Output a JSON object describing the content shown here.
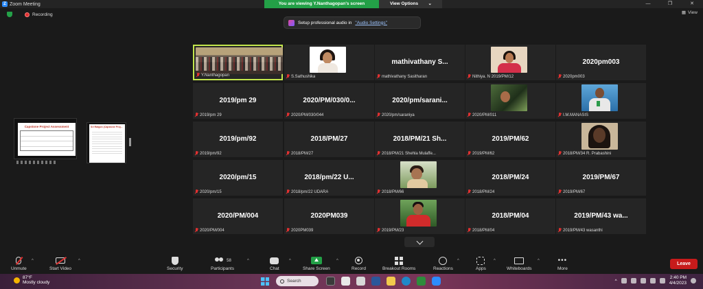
{
  "window": {
    "title": "Zoom Meeting",
    "controls": [
      "—",
      "❐",
      "✕"
    ]
  },
  "banner": {
    "viewing": "You are viewing Y.Nanthagopan's screen",
    "view_options": "View Options",
    "caret": "⌄"
  },
  "status": {
    "recording": "Recording",
    "view": "View"
  },
  "audio_tip": {
    "text": "Setup professional audio in",
    "link": "\"Audio Settings\""
  },
  "slides": {
    "thumb1_title": "Capstone Project Assessment",
    "thumb2_title": "Sri Ratgon (Capstone Proj..."
  },
  "participants": [
    {
      "label": "Y.Nanthagopan",
      "big": "",
      "photo": "room",
      "active": true
    },
    {
      "label": "S.Sathushika",
      "big": "",
      "photo": "girl1"
    },
    {
      "label": "mathivathany Sasitharan",
      "big": "mathivathany  S..."
    },
    {
      "label": "Nithiya. N 2019/PM/12",
      "big": "",
      "photo": "girl2"
    },
    {
      "label": "2020pm003",
      "big": "2020pm003"
    },
    {
      "label": "2019/pm 29",
      "big": "2019/pm 29"
    },
    {
      "label": "2020/PM/030/044",
      "big": "2020/PM/030/0..."
    },
    {
      "label": "2020/pm/saraniya",
      "big": "2020/pm/sarani..."
    },
    {
      "label": "2020/PM/011",
      "big": "",
      "photo": "boyg"
    },
    {
      "label": "I.M.MANASIS",
      "big": "",
      "photo": "man"
    },
    {
      "label": "2019/pm/92",
      "big": "2019/pm/92"
    },
    {
      "label": "2018/PM/27",
      "big": "2018/PM/27"
    },
    {
      "label": "2018/PM/21 Shehla Mulaffe...",
      "big": "2018/PM/21  Sh..."
    },
    {
      "label": "2019/PM/62",
      "big": "2019/PM/62"
    },
    {
      "label": "2018/PM/34 R. Prabashini",
      "big": "",
      "photo": "woman"
    },
    {
      "label": "2020/pm/15",
      "big": "2020/pm/15"
    },
    {
      "label": "2018/pm/22  UDARA",
      "big": "2018/pm/22   U..."
    },
    {
      "label": "2018/PM/66",
      "big": "",
      "photo": "outdoor"
    },
    {
      "label": "2018/PM/24",
      "big": "2018/PM/24"
    },
    {
      "label": "2019/PM/67",
      "big": "2019/PM/67"
    },
    {
      "label": "2020/PM/004",
      "big": "2020/PM/004"
    },
    {
      "label": "2020PM039",
      "big": "2020PM039"
    },
    {
      "label": "2019/PM/23",
      "big": "",
      "photo": "redboy"
    },
    {
      "label": "2018/PM/04",
      "big": "2018/PM/04"
    },
    {
      "label": "2019/PM/43 wasanthi",
      "big": "2019/PM/43   wa..."
    }
  ],
  "toolbar": {
    "unmute": "Unmute",
    "start_video": "Start Video",
    "security": "Security",
    "participants": "Participants",
    "participants_count": "58",
    "chat": "Chat",
    "share_screen": "Share Screen",
    "record": "Record",
    "breakout_rooms": "Breakout Rooms",
    "reactions": "Reactions",
    "apps": "Apps",
    "whiteboards": "Whiteboards",
    "more": "More",
    "leave": "Leave",
    "caret": "^"
  },
  "taskbar": {
    "temperature": "87°F",
    "weather": "Mostly cloudy",
    "search": "Search",
    "time": "2:40 PM",
    "date": "4/4/2023"
  },
  "colors": {
    "active_speaker": "#c3e64c",
    "share_green": "#23a047",
    "leave_red": "#c71b1b",
    "muted_red": "#e03131"
  }
}
